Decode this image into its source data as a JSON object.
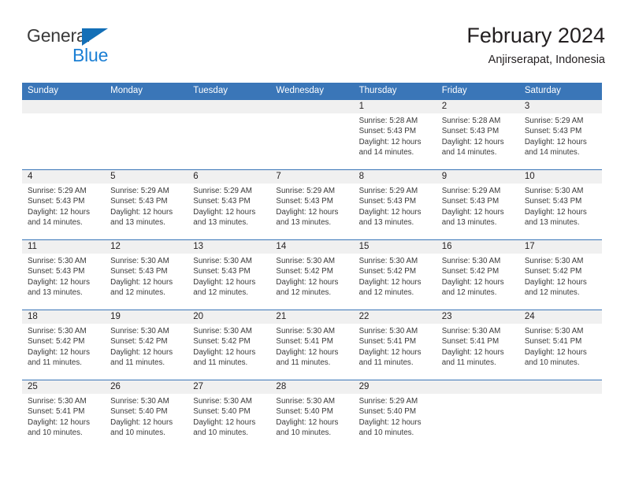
{
  "brand": {
    "name_top": "General",
    "name_bottom": "Blue",
    "triangle_icon": "triangle-icon",
    "color_dark": "#3a3a3a",
    "color_blue": "#1b7fd4"
  },
  "header": {
    "title": "February 2024",
    "subtitle": "Anjirserapat, Indonesia"
  },
  "theme": {
    "header_blue": "#3a76b8",
    "band_gray": "#f0f0f0",
    "text": "#231f20"
  },
  "weekdays": [
    "Sunday",
    "Monday",
    "Tuesday",
    "Wednesday",
    "Thursday",
    "Friday",
    "Saturday"
  ],
  "labels": {
    "sunrise_prefix": "Sunrise:",
    "sunset_prefix": "Sunset:",
    "daylight_prefix": "Daylight:"
  },
  "weeks": [
    [
      {
        "day": "",
        "empty": true
      },
      {
        "day": "",
        "empty": true
      },
      {
        "day": "",
        "empty": true
      },
      {
        "day": "",
        "empty": true
      },
      {
        "day": "1",
        "sunrise": "Sunrise: 5:28 AM",
        "sunset": "Sunset: 5:43 PM",
        "daylight": "Daylight: 12 hours and 14 minutes."
      },
      {
        "day": "2",
        "sunrise": "Sunrise: 5:28 AM",
        "sunset": "Sunset: 5:43 PM",
        "daylight": "Daylight: 12 hours and 14 minutes."
      },
      {
        "day": "3",
        "sunrise": "Sunrise: 5:29 AM",
        "sunset": "Sunset: 5:43 PM",
        "daylight": "Daylight: 12 hours and 14 minutes."
      }
    ],
    [
      {
        "day": "4",
        "sunrise": "Sunrise: 5:29 AM",
        "sunset": "Sunset: 5:43 PM",
        "daylight": "Daylight: 12 hours and 14 minutes."
      },
      {
        "day": "5",
        "sunrise": "Sunrise: 5:29 AM",
        "sunset": "Sunset: 5:43 PM",
        "daylight": "Daylight: 12 hours and 13 minutes."
      },
      {
        "day": "6",
        "sunrise": "Sunrise: 5:29 AM",
        "sunset": "Sunset: 5:43 PM",
        "daylight": "Daylight: 12 hours and 13 minutes."
      },
      {
        "day": "7",
        "sunrise": "Sunrise: 5:29 AM",
        "sunset": "Sunset: 5:43 PM",
        "daylight": "Daylight: 12 hours and 13 minutes."
      },
      {
        "day": "8",
        "sunrise": "Sunrise: 5:29 AM",
        "sunset": "Sunset: 5:43 PM",
        "daylight": "Daylight: 12 hours and 13 minutes."
      },
      {
        "day": "9",
        "sunrise": "Sunrise: 5:29 AM",
        "sunset": "Sunset: 5:43 PM",
        "daylight": "Daylight: 12 hours and 13 minutes."
      },
      {
        "day": "10",
        "sunrise": "Sunrise: 5:30 AM",
        "sunset": "Sunset: 5:43 PM",
        "daylight": "Daylight: 12 hours and 13 minutes."
      }
    ],
    [
      {
        "day": "11",
        "sunrise": "Sunrise: 5:30 AM",
        "sunset": "Sunset: 5:43 PM",
        "daylight": "Daylight: 12 hours and 13 minutes."
      },
      {
        "day": "12",
        "sunrise": "Sunrise: 5:30 AM",
        "sunset": "Sunset: 5:43 PM",
        "daylight": "Daylight: 12 hours and 12 minutes."
      },
      {
        "day": "13",
        "sunrise": "Sunrise: 5:30 AM",
        "sunset": "Sunset: 5:43 PM",
        "daylight": "Daylight: 12 hours and 12 minutes."
      },
      {
        "day": "14",
        "sunrise": "Sunrise: 5:30 AM",
        "sunset": "Sunset: 5:42 PM",
        "daylight": "Daylight: 12 hours and 12 minutes."
      },
      {
        "day": "15",
        "sunrise": "Sunrise: 5:30 AM",
        "sunset": "Sunset: 5:42 PM",
        "daylight": "Daylight: 12 hours and 12 minutes."
      },
      {
        "day": "16",
        "sunrise": "Sunrise: 5:30 AM",
        "sunset": "Sunset: 5:42 PM",
        "daylight": "Daylight: 12 hours and 12 minutes."
      },
      {
        "day": "17",
        "sunrise": "Sunrise: 5:30 AM",
        "sunset": "Sunset: 5:42 PM",
        "daylight": "Daylight: 12 hours and 12 minutes."
      }
    ],
    [
      {
        "day": "18",
        "sunrise": "Sunrise: 5:30 AM",
        "sunset": "Sunset: 5:42 PM",
        "daylight": "Daylight: 12 hours and 11 minutes."
      },
      {
        "day": "19",
        "sunrise": "Sunrise: 5:30 AM",
        "sunset": "Sunset: 5:42 PM",
        "daylight": "Daylight: 12 hours and 11 minutes."
      },
      {
        "day": "20",
        "sunrise": "Sunrise: 5:30 AM",
        "sunset": "Sunset: 5:42 PM",
        "daylight": "Daylight: 12 hours and 11 minutes."
      },
      {
        "day": "21",
        "sunrise": "Sunrise: 5:30 AM",
        "sunset": "Sunset: 5:41 PM",
        "daylight": "Daylight: 12 hours and 11 minutes."
      },
      {
        "day": "22",
        "sunrise": "Sunrise: 5:30 AM",
        "sunset": "Sunset: 5:41 PM",
        "daylight": "Daylight: 12 hours and 11 minutes."
      },
      {
        "day": "23",
        "sunrise": "Sunrise: 5:30 AM",
        "sunset": "Sunset: 5:41 PM",
        "daylight": "Daylight: 12 hours and 11 minutes."
      },
      {
        "day": "24",
        "sunrise": "Sunrise: 5:30 AM",
        "sunset": "Sunset: 5:41 PM",
        "daylight": "Daylight: 12 hours and 10 minutes."
      }
    ],
    [
      {
        "day": "25",
        "sunrise": "Sunrise: 5:30 AM",
        "sunset": "Sunset: 5:41 PM",
        "daylight": "Daylight: 12 hours and 10 minutes."
      },
      {
        "day": "26",
        "sunrise": "Sunrise: 5:30 AM",
        "sunset": "Sunset: 5:40 PM",
        "daylight": "Daylight: 12 hours and 10 minutes."
      },
      {
        "day": "27",
        "sunrise": "Sunrise: 5:30 AM",
        "sunset": "Sunset: 5:40 PM",
        "daylight": "Daylight: 12 hours and 10 minutes."
      },
      {
        "day": "28",
        "sunrise": "Sunrise: 5:30 AM",
        "sunset": "Sunset: 5:40 PM",
        "daylight": "Daylight: 12 hours and 10 minutes."
      },
      {
        "day": "29",
        "sunrise": "Sunrise: 5:29 AM",
        "sunset": "Sunset: 5:40 PM",
        "daylight": "Daylight: 12 hours and 10 minutes."
      },
      {
        "day": "",
        "empty": true
      },
      {
        "day": "",
        "empty": true
      }
    ]
  ]
}
